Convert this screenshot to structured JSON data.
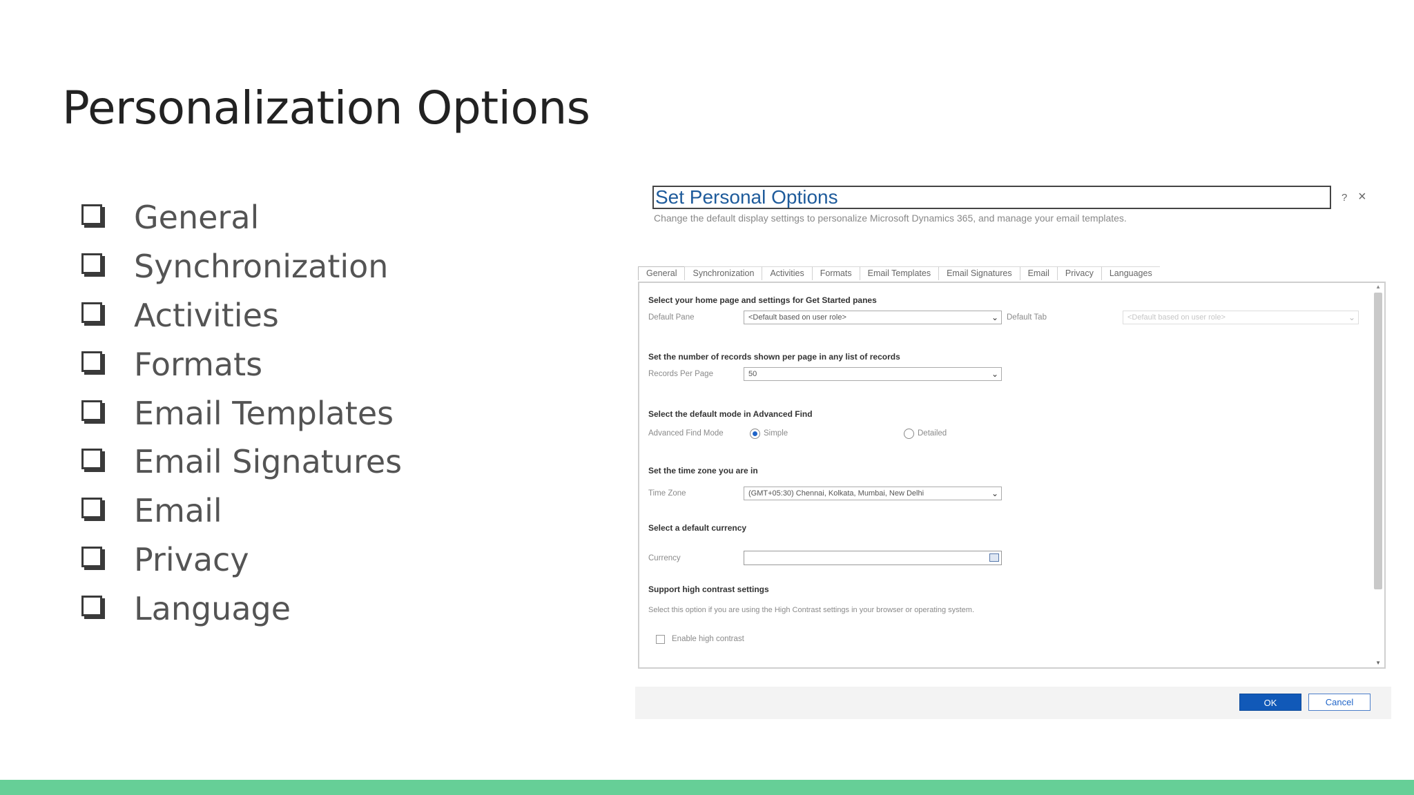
{
  "slide": {
    "title": "Personalization Options",
    "bullets": [
      "General",
      "Synchronization",
      "Activities",
      "Formats",
      "Email Templates",
      "Email Signatures",
      "Email",
      "Privacy",
      "Language"
    ],
    "accent_color": "#66cf97"
  },
  "dialog": {
    "title": "Set Personal Options",
    "help": "?",
    "close": "×",
    "subtitle": "Change the default display settings to personalize Microsoft Dynamics 365, and manage your email templates.",
    "tabs": [
      "General",
      "Synchronization",
      "Activities",
      "Formats",
      "Email Templates",
      "Email Signatures",
      "Email",
      "Privacy",
      "Languages"
    ],
    "sections": {
      "home": {
        "heading": "Select your home page and settings for Get Started panes",
        "default_pane_label": "Default Pane",
        "default_pane_value": "<Default based on user role>",
        "default_tab_label": "Default Tab",
        "default_tab_value": "<Default based on user role>"
      },
      "records": {
        "heading": "Set the number of records shown per page in any list of records",
        "label": "Records Per Page",
        "value": "50"
      },
      "advanced_find": {
        "heading": "Select the default mode in Advanced Find",
        "label": "Advanced Find Mode",
        "option_simple": "Simple",
        "option_detailed": "Detailed",
        "selected": "Simple"
      },
      "timezone": {
        "heading": "Set the time zone you are in",
        "label": "Time Zone",
        "value": "(GMT+05:30) Chennai, Kolkata, Mumbai, New Delhi"
      },
      "currency": {
        "heading": "Select a default currency",
        "label": "Currency",
        "value": ""
      },
      "contrast": {
        "heading": "Support high contrast settings",
        "description": "Select this option if you are using the High Contrast settings in your browser or operating system.",
        "checkbox_label": "Enable high contrast",
        "checked": false
      }
    },
    "buttons": {
      "ok": "OK",
      "cancel": "Cancel"
    }
  }
}
